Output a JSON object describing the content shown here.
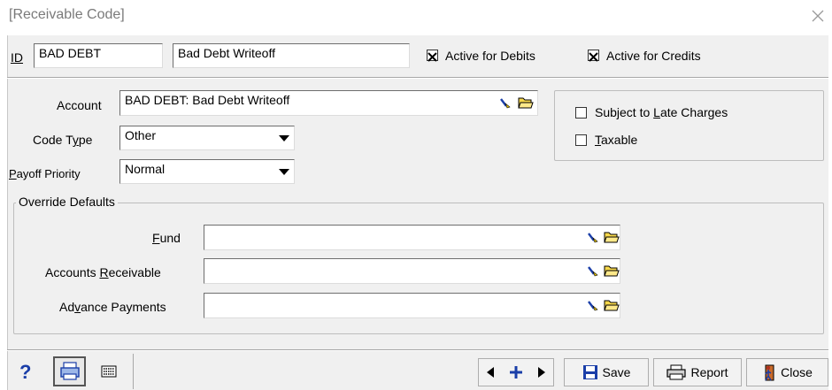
{
  "window": {
    "title": "[Receivable Code]"
  },
  "header": {
    "id_label": "ID",
    "id_value": "BAD DEBT",
    "description_value": "Bad Debt Writeoff",
    "active_debits_label": "Active for Debits",
    "active_debits_checked": true,
    "active_credits_label": "Active for Credits",
    "active_credits_checked": true
  },
  "form": {
    "account_label": "Account",
    "account_value": "BAD DEBT: Bad Debt Writeoff",
    "code_type_label": "Code Type",
    "code_type_value": "Other",
    "payoff_priority_label": "Payoff Priority",
    "payoff_priority_value": "Normal"
  },
  "options": {
    "late_charges_label": "Subject to Late Charges",
    "late_charges_checked": false,
    "taxable_label": "Taxable",
    "taxable_checked": false
  },
  "override": {
    "title": "Override Defaults",
    "fund_label": "Fund",
    "fund_value": "",
    "ar_label": "Accounts Receivable",
    "ar_value": "",
    "advance_label": "Advance Payments",
    "advance_value": ""
  },
  "toolbar": {
    "save_label": "Save",
    "report_label": "Report",
    "close_label": "Close",
    "help_glyph": "?"
  },
  "colors": {
    "accent_blue": "#1a3ea8",
    "icon_yellow": "#e8c400",
    "close_red": "#b03020"
  }
}
